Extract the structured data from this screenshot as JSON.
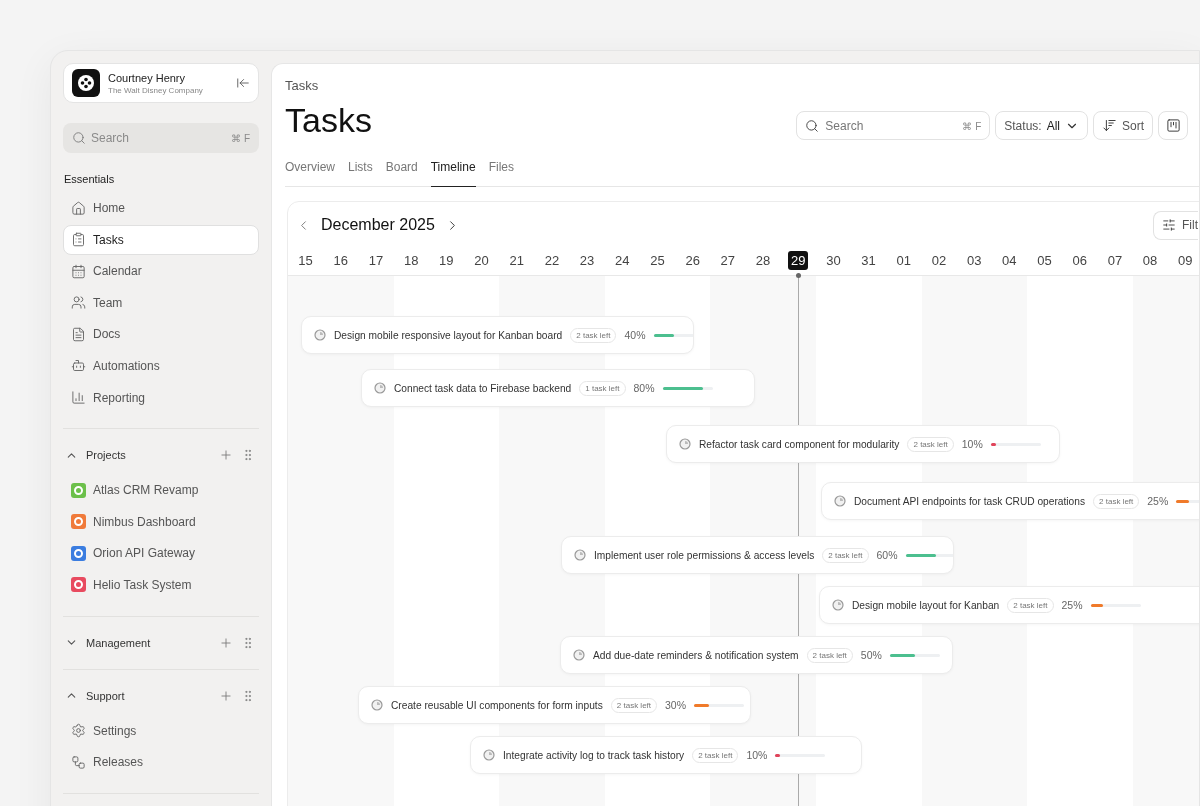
{
  "sidebar": {
    "profile": {
      "name": "Courtney Henry",
      "company": "The Walt Disney Company"
    },
    "search": {
      "placeholder": "Search",
      "shortcut": "⌘ F"
    },
    "sections": [
      {
        "kind": "plain",
        "title": "Essentials",
        "items": [
          {
            "label": "Home",
            "selected": false
          },
          {
            "label": "Tasks",
            "selected": true
          },
          {
            "label": "Calendar",
            "selected": false
          },
          {
            "label": "Team",
            "selected": false
          },
          {
            "label": "Docs",
            "selected": false
          },
          {
            "label": "Automations",
            "selected": false
          },
          {
            "label": "Reporting",
            "selected": false
          }
        ]
      },
      {
        "kind": "collapsible",
        "title": "Projects",
        "expanded": true,
        "items": [
          {
            "label": "Atlas CRM Revamp",
            "selected": false,
            "color": "#6cc04a"
          },
          {
            "label": "Nimbus Dashboard",
            "selected": false,
            "color": "#f07a3a"
          },
          {
            "label": "Orion API Gateway",
            "selected": false,
            "color": "#3b7de0"
          },
          {
            "label": "Helio Task System",
            "selected": false,
            "color": "#e84a5f"
          }
        ]
      },
      {
        "kind": "collapsible",
        "title": "Management",
        "expanded": false
      },
      {
        "kind": "collapsible",
        "title": "Support",
        "expanded": true,
        "items": [
          {
            "label": "Settings",
            "selected": false
          },
          {
            "label": "Releases",
            "selected": false
          }
        ]
      }
    ]
  },
  "main": {
    "breadcrumb": "Tasks",
    "title": "Tasks",
    "search": {
      "placeholder": "Search",
      "shortcut": "⌘ F"
    },
    "status_filter": {
      "label": "Status:",
      "value": "All"
    },
    "sort_button": "Sort",
    "tabs": [
      {
        "label": "Overview",
        "selected": false
      },
      {
        "label": "Lists",
        "selected": false
      },
      {
        "label": "Board",
        "selected": false
      },
      {
        "label": "Timeline",
        "selected": true
      },
      {
        "label": "Files",
        "selected": false
      }
    ],
    "timeline": {
      "month": "December 2025",
      "filter_button": "Filt",
      "days": [
        {
          "label": "15",
          "selected": false
        },
        {
          "label": "16",
          "selected": false
        },
        {
          "label": "17",
          "selected": false
        },
        {
          "label": "18",
          "selected": false
        },
        {
          "label": "19",
          "selected": false
        },
        {
          "label": "20",
          "selected": false
        },
        {
          "label": "21",
          "selected": false
        },
        {
          "label": "22",
          "selected": false
        },
        {
          "label": "23",
          "selected": false
        },
        {
          "label": "24",
          "selected": false
        },
        {
          "label": "25",
          "selected": false
        },
        {
          "label": "26",
          "selected": false
        },
        {
          "label": "27",
          "selected": false
        },
        {
          "label": "28",
          "selected": false
        },
        {
          "label": "29",
          "selected": true
        },
        {
          "label": "30",
          "selected": false
        },
        {
          "label": "31",
          "selected": false
        },
        {
          "label": "01",
          "selected": false
        },
        {
          "label": "02",
          "selected": false
        },
        {
          "label": "03",
          "selected": false
        },
        {
          "label": "04",
          "selected": false
        },
        {
          "label": "05",
          "selected": false
        },
        {
          "label": "06",
          "selected": false
        },
        {
          "label": "07",
          "selected": false
        },
        {
          "label": "08",
          "selected": false
        },
        {
          "label": "09",
          "selected": false
        }
      ],
      "tasks": [
        {
          "title": "Design mobile responsive layout for Kanban board",
          "tag": "2 task left",
          "percent": "40%",
          "level": 0.4,
          "color": "#4cbf8f"
        },
        {
          "title": "Connect task data to Firebase backend",
          "tag": "1 task left",
          "percent": "80%",
          "level": 0.8,
          "color": "#4cbf8f"
        },
        {
          "title": "Refactor task card component for modularity",
          "tag": "2 task left",
          "percent": "10%",
          "level": 0.1,
          "color": "#e0445a"
        },
        {
          "title": "Document API endpoints for task CRUD operations",
          "tag": "2 task left",
          "percent": "25%",
          "level": 0.25,
          "color": "#f07a2a"
        },
        {
          "title": "Implement user role permissions & access levels",
          "tag": "2 task left",
          "percent": "60%",
          "level": 0.6,
          "color": "#4cbf8f"
        },
        {
          "title": "Design mobile layout for Kanban",
          "tag": "2 task left",
          "percent": "25%",
          "level": 0.25,
          "color": "#f07a2a"
        },
        {
          "title": "Add due-date reminders & notification system",
          "tag": "2 task left",
          "percent": "50%",
          "level": 0.5,
          "color": "#4cbf8f"
        },
        {
          "title": "Create reusable UI components for form inputs",
          "tag": "2 task left",
          "percent": "30%",
          "level": 0.3,
          "color": "#f07a2a"
        },
        {
          "title": "Integrate activity log to track task history",
          "tag": "2 task left",
          "percent": "10%",
          "level": 0.1,
          "color": "#e0445a"
        }
      ]
    }
  }
}
